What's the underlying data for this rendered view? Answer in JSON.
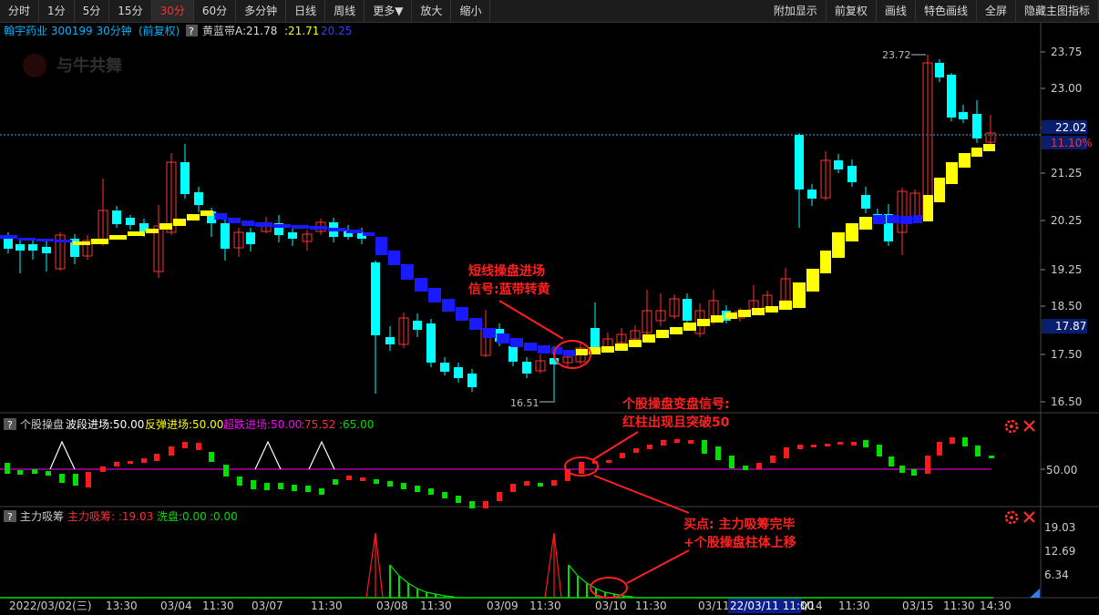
{
  "toolbar": {
    "periods": [
      "分时",
      "1分",
      "5分",
      "15分",
      "30分",
      "60分",
      "多分钟",
      "日线",
      "周线",
      "更多▼",
      "放大",
      "缩小"
    ],
    "active_period": "30分",
    "right": [
      "附加显示",
      "前复权",
      "画线",
      "特色画线",
      "全屏",
      "隐藏主图指标"
    ]
  },
  "header": {
    "stock": "翰宇药业 300199 30分钟",
    "adjust": "(前复权)",
    "help": "?",
    "indicator": "黄蓝带",
    "vals": [
      "A:21.78",
      ":21.71",
      "20.25"
    ]
  },
  "watermark": "与牛共舞",
  "price_axis": {
    "ticks": [
      "23.75",
      "23.00",
      "22.00",
      "21.25",
      "20.25",
      "19.25",
      "18.50",
      "17.50",
      "16.50"
    ],
    "current": "22.02",
    "change": "11.10%",
    "level": "17.87"
  },
  "markers": {
    "high": "23.72",
    "low": "16.51"
  },
  "annotations": {
    "a1": [
      "短线操盘进场",
      "信号:蓝带转黄"
    ],
    "a2": [
      "个股操盘变盘信号:",
      "红柱出现且突破50"
    ],
    "a3": [
      "买点: 主力吸筹完毕",
      "+个股操盘柱体上移"
    ]
  },
  "panel2": {
    "help": "?",
    "title": "个股操盘",
    "l1": "波段进场:50.00",
    "l2": "反弹进场:50.00",
    "l3": "超跌进场:50.00",
    "l4": ":75.52",
    "l5": ":65.00",
    "axis": "50.00"
  },
  "panel3": {
    "help": "?",
    "title": "主力吸筹",
    "l1": "主力吸筹: :19.03",
    "l2": "洗盘:0.00",
    "l3": ":0.00",
    "axis": [
      "19.03",
      "12.69",
      "6.34"
    ]
  },
  "time_axis": [
    "2022/03/02(三)",
    "13:30",
    "03/04",
    "11:30",
    "03/07",
    "11:30",
    "03/08",
    "11:30",
    "03/09",
    "11:30",
    "03/10",
    "11:30",
    "03/11",
    "11:30",
    "03/14",
    "11:30",
    "03/15",
    "11:30",
    "14:30"
  ],
  "time_cursor": "22/03/11 11:00",
  "colors": {
    "up": "#ff3232",
    "down": "#00ffff",
    "band_up": "#ffff00",
    "band_down": "#1a1aff",
    "green": "#00e000",
    "magenta": "#ff00ff"
  }
}
